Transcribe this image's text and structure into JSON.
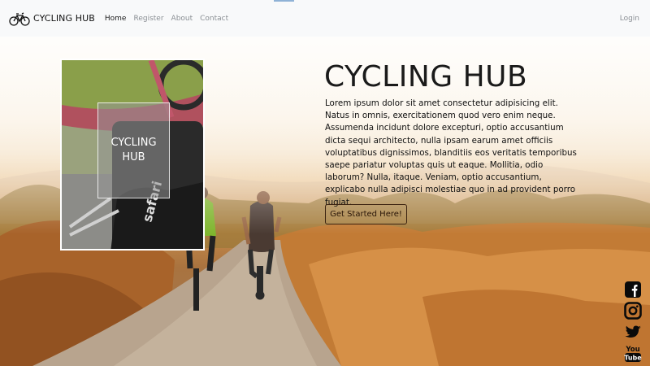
{
  "navbar": {
    "brand": "CYCLING HUB",
    "links": [
      {
        "label": "Home",
        "active": true
      },
      {
        "label": "Register",
        "active": false
      },
      {
        "label": "About",
        "active": false
      },
      {
        "label": "Contact",
        "active": false
      }
    ],
    "login": "Login",
    "icon": "bicycle-icon"
  },
  "hero": {
    "title": "CYCLING HUB",
    "description": "Lorem ipsum dolor sit amet consectetur adipisicing elit. Natus in omnis, exercitationem quod vero enim neque. Assumenda incidunt dolore excepturi, optio accusantium dicta sequi architecto, nulla ipsam earum amet officiis voluptatibus dignissimos, blanditiis eos veritatis temporibus saepe pariatur voluptas quis ut eaque. Mollitia, odio laborum? Nulla, itaque. Veniam, optio accusantium, explicabo nulla adipisci molestiae quo in ad provident porro fugiat.",
    "cta": "Get Started Here!"
  },
  "card": {
    "logo_line1": "CYCLING",
    "logo_line2": "HUB"
  },
  "social": [
    "facebook-icon",
    "instagram-icon",
    "twitter-icon",
    "youtube-icon"
  ],
  "colors": {
    "navbar_bg": "#f8f9fa",
    "title": "#1a1a1a",
    "cta_border": "#3a2210",
    "social_icons": "#0a0a0a"
  }
}
